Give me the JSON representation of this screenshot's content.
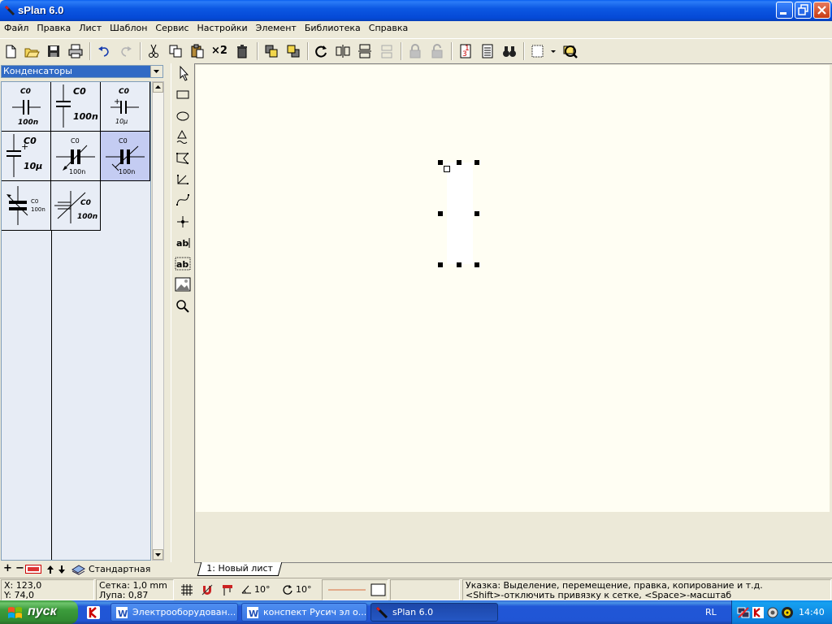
{
  "window": {
    "title": "sPlan 6.0"
  },
  "menu": [
    "Файл",
    "Правка",
    "Лист",
    "Шаблон",
    "Сервис",
    "Настройки",
    "Элемент",
    "Библиотека",
    "Справка"
  ],
  "toolbar": {
    "duplicate_label": "×2",
    "buttons": [
      "new-file-icon",
      "open-folder-icon",
      "save-icon",
      "print-icon",
      "undo-icon",
      "redo-icon",
      "cut-icon",
      "copy-icon",
      "paste-icon",
      "duplicate-icon",
      "delete-icon",
      "bring-front-icon",
      "send-back-icon",
      "rotate-icon",
      "mirror-horizontal-icon",
      "mirror-vertical-icon",
      "mirror-disabled-icon",
      "lock-icon",
      "unlock-icon",
      "renumber-icon",
      "parts-list-icon",
      "find-icon",
      "grid-icon",
      "zoom-icon"
    ]
  },
  "library": {
    "selected": "Конденсаторы",
    "components": [
      {
        "name": "C0",
        "value": "100n"
      },
      {
        "name": "C0",
        "value": "100n"
      },
      {
        "name": "C0",
        "value": "10µ"
      },
      {
        "name": "C0",
        "value": "10µ"
      },
      {
        "name": "C0",
        "value": "100n"
      },
      {
        "name": "C0",
        "value": "100n"
      },
      {
        "name": "C0",
        "value": "100n"
      },
      {
        "name": "C0",
        "value": "100n"
      }
    ],
    "footer_label": "Стандартная"
  },
  "sheet_tab": "1: Новый лист",
  "status": {
    "x": "X: 123,0",
    "y": "Y: 74,0",
    "grid": "Сетка:  1,0 mm",
    "zoom": "Лупа:   0,87",
    "angle1": "10°",
    "angle2": "10°",
    "hint_line1": "Указка: Выделение, перемещение, правка, копирование и т.д.",
    "hint_line2": "<Shift>-отключить привязку к сетке, <Space>-масштаб"
  },
  "taskbar": {
    "start_label": "пуск",
    "tasks": [
      "Электрооборудован...",
      "конспект Русич эл о...",
      "sPlan 6.0"
    ],
    "active_index": 2,
    "lang": "RL",
    "clock": "14:40"
  },
  "colors": {
    "canvas": "#fffef3",
    "selected_cell": "#c4ccf2",
    "titlebar": "#0549d6",
    "start_green": "#3c9c3c"
  }
}
